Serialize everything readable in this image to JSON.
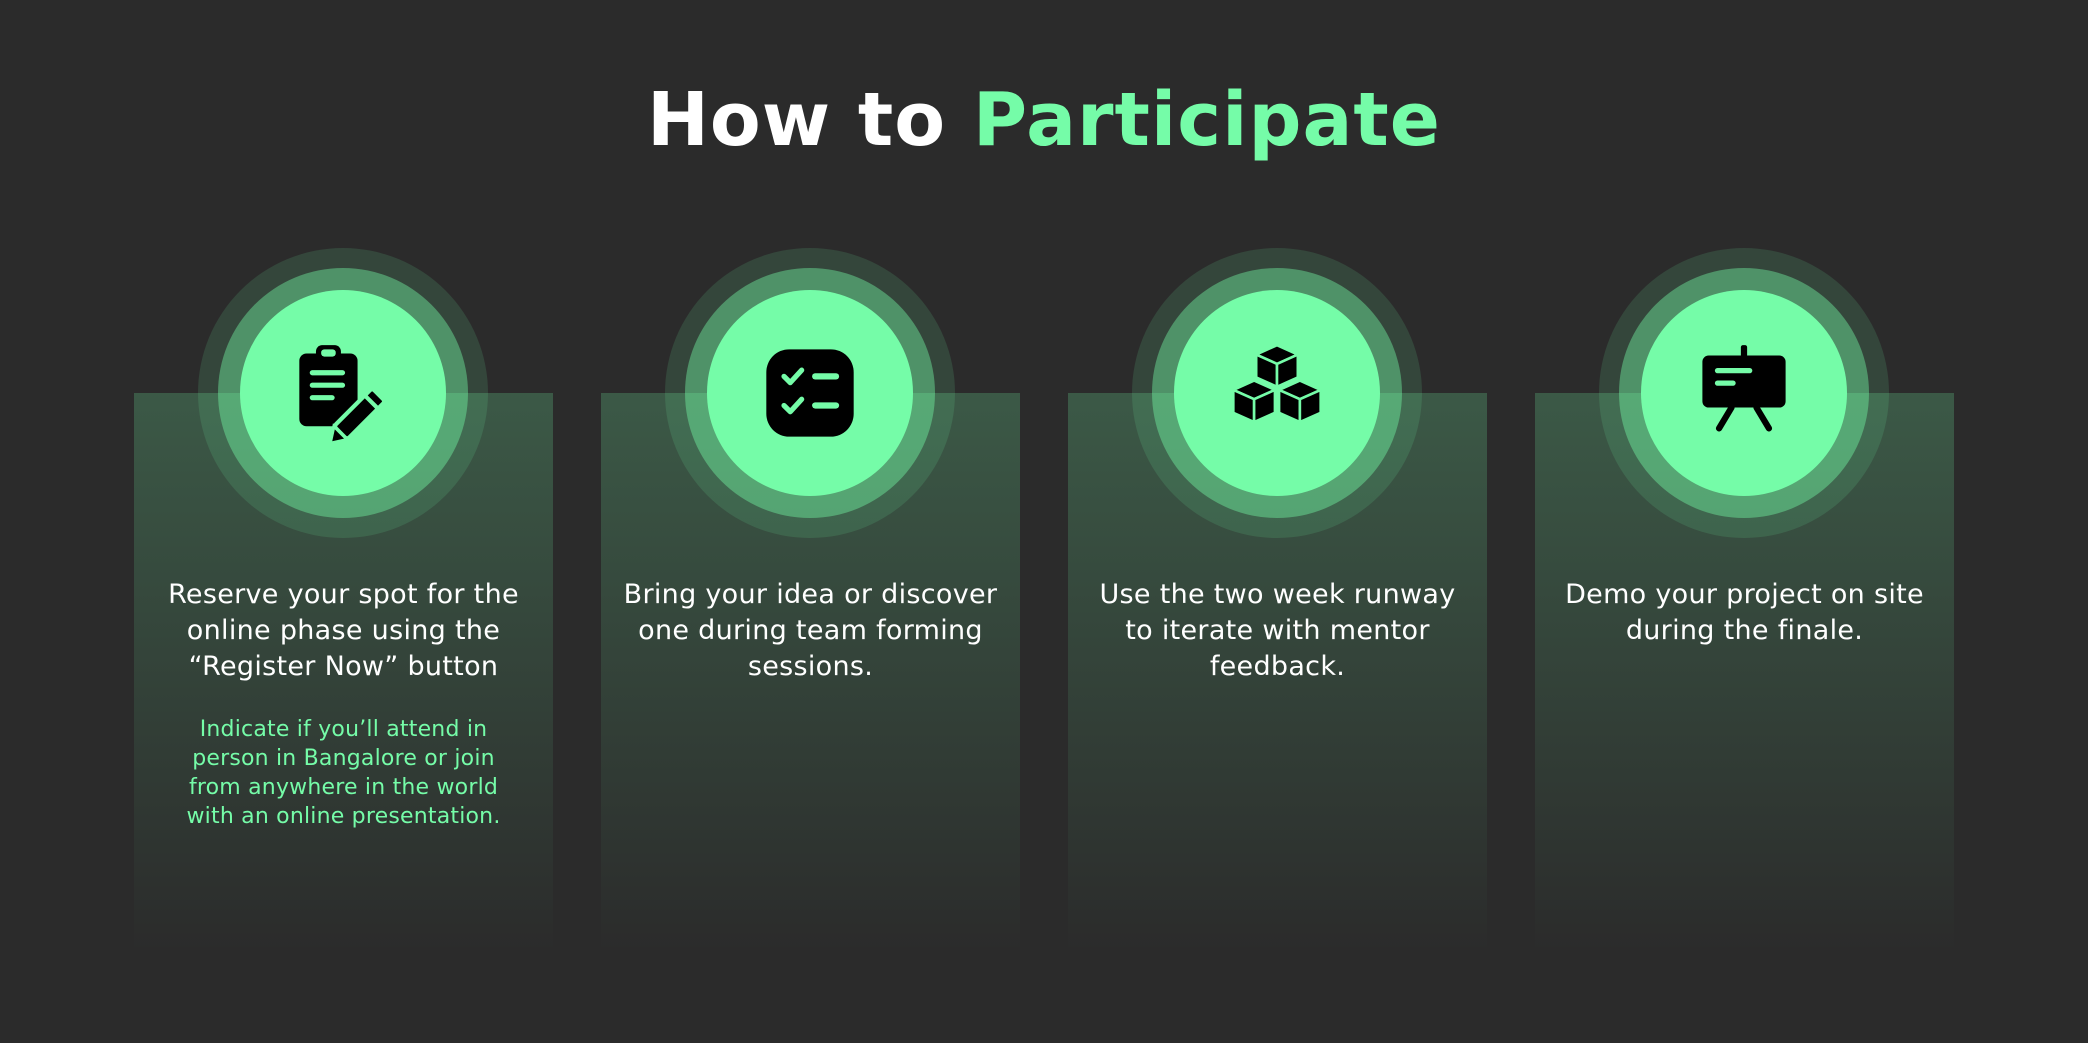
{
  "header": {
    "title_prefix": "How to",
    "title_accent": "Participate"
  },
  "colors": {
    "background": "#2b2b2b",
    "accent": "#75fca8",
    "text": "#ffffff"
  },
  "steps": [
    {
      "icon": "clipboard-edit-icon",
      "text": "Reserve your spot for the online phase using the “Register Now” button",
      "note": "Indicate if you’ll attend in person in Bangalore or join from anywhere in the world with an online presentation."
    },
    {
      "icon": "checklist-icon",
      "text": "Bring your idea or discover one during team forming sessions."
    },
    {
      "icon": "cubes-icon",
      "text": "Use the two week runway to iterate with mentor feedback."
    },
    {
      "icon": "presentation-board-icon",
      "text": "Demo your project on site during the finale."
    }
  ]
}
